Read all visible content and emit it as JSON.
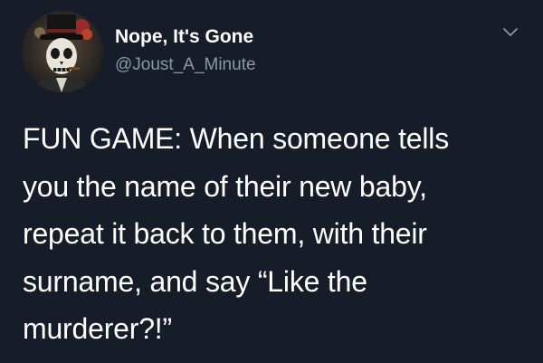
{
  "tweet": {
    "author": {
      "display_name": "Nope, It's Gone",
      "handle": "@Joust_A_Minute",
      "avatar_icon": "skull-top-hat-avatar"
    },
    "menu_icon": "chevron-down-icon",
    "text_lines": [
      "FUN GAME: When someone tells",
      "you the name of their new baby,",
      "repeat it back to them, with their",
      "surname, and say “Like the",
      "murderer?!”"
    ]
  },
  "colors": {
    "background": "#161d28",
    "text_primary": "#ffffff",
    "text_secondary": "#8b98a5"
  }
}
